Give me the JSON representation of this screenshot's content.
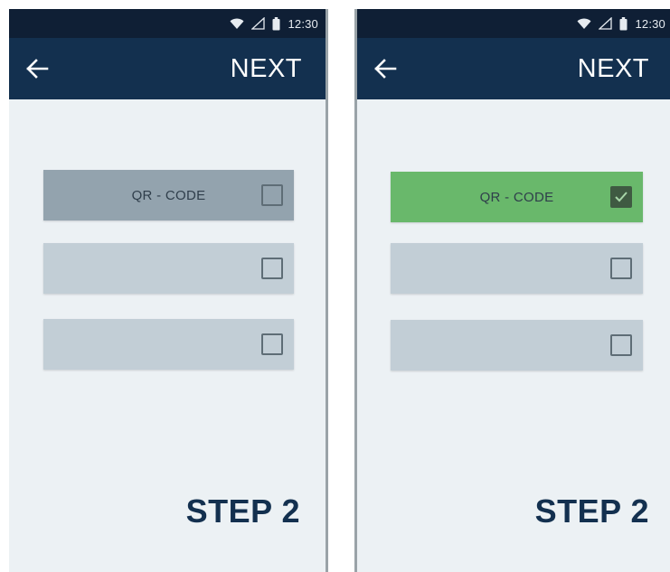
{
  "screens": [
    {
      "status": {
        "time": "12:30"
      },
      "app_bar": {
        "next_label": "NEXT"
      },
      "options": [
        {
          "label": "QR - CODE",
          "checked": false
        },
        {
          "label": "",
          "checked": false
        },
        {
          "label": "",
          "checked": false
        }
      ],
      "step_label": "STEP 2"
    },
    {
      "status": {
        "time": "12:30"
      },
      "app_bar": {
        "next_label": "NEXT"
      },
      "options": [
        {
          "label": "QR - CODE",
          "checked": true
        },
        {
          "label": "",
          "checked": false
        },
        {
          "label": "",
          "checked": false
        }
      ],
      "step_label": "STEP 2"
    }
  ],
  "colors": {
    "status_bar": "#0f1f35",
    "app_bar": "#13304f",
    "background": "#ecf1f4",
    "option_default": "#c2ced6",
    "option_selected_grey": "#93a3ae",
    "option_selected_green": "#69b86b",
    "step_text": "#13304f"
  },
  "icons": [
    "wifi-icon",
    "signal-icon",
    "battery-icon",
    "back-arrow-icon",
    "checkbox-icon",
    "checkmark-icon"
  ]
}
